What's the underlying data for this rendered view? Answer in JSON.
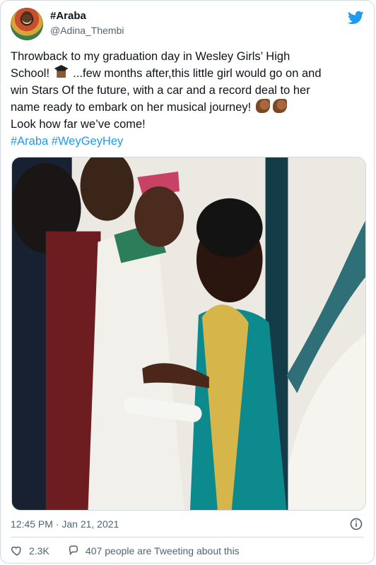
{
  "tweet": {
    "display_name": "#Araba",
    "handle": "@Adina_Thembi",
    "text_lines": [
      "Throwback to my graduation day in Wesley Girls’ High",
      "School!",
      "...few months after,this little girl would go on and",
      "win Stars Of the future, with a car and a record deal to her",
      "name ready to embark on her musical journey!",
      "Look how far we’ve come!"
    ],
    "hashtags": [
      "#Araba",
      "#WeyGeyHey"
    ],
    "timestamp": "12:45 PM · Jan 21, 2021",
    "likes": "2.3K",
    "tweeting_about": "407 people are Tweeting about this"
  },
  "icons": {
    "brand": "twitter-icon",
    "info": "info-icon",
    "like": "heart-icon",
    "reply": "speech-bubble-icon"
  },
  "colors": {
    "brand": "#1d9bf0",
    "text": "#0f1419",
    "secondary": "#536471",
    "border": "#cfd9de"
  }
}
